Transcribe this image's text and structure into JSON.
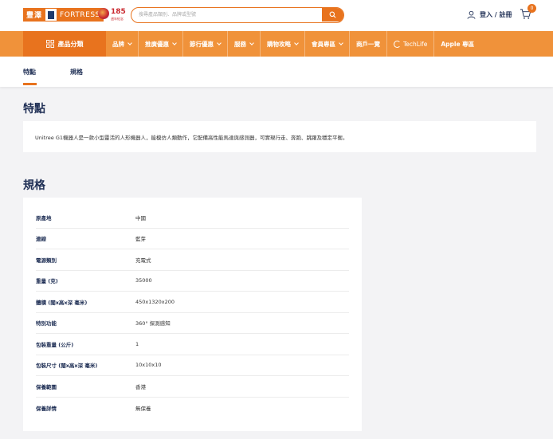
{
  "header": {
    "logo_cn": "豐澤",
    "logo_en": "FORTRESS",
    "anniversary_number": "185",
    "anniversary_sub": "週年紀念",
    "search_placeholder": "搜尋產品類別、品牌或型號",
    "login_label": "登入 / 註冊",
    "cart_count": "0",
    "colors": {
      "brand_orange": "#e8731e",
      "nav_orange": "#f0923a",
      "navy": "#1f2f55"
    }
  },
  "nav": {
    "category_label": "產品分類",
    "items": [
      {
        "label": "品牌",
        "dropdown": true
      },
      {
        "label": "推廣優惠",
        "dropdown": true
      },
      {
        "label": "節行優惠",
        "dropdown": true
      },
      {
        "label": "服務",
        "dropdown": true
      },
      {
        "label": "購物攻略",
        "dropdown": true
      },
      {
        "label": "會員專區",
        "dropdown": true
      },
      {
        "label": "商戶一覽",
        "dropdown": false
      },
      {
        "label": "TechLife",
        "dropdown": false
      },
      {
        "label": "Apple 專區",
        "dropdown": false
      }
    ]
  },
  "tabs": [
    {
      "label": "特點",
      "active": true
    },
    {
      "label": "規格",
      "active": false
    }
  ],
  "features": {
    "heading": "特點",
    "text": "Unitree G1機器人是一款小型靈活的人形機器人，能模仿人類動作，它配備高性能馬達與感測器，可實現行走、奔跑、跳躍及穩定平衡。"
  },
  "specs": {
    "heading": "規格",
    "rows": [
      {
        "label": "原產地",
        "value": "中國"
      },
      {
        "label": "連線",
        "value": "藍芽"
      },
      {
        "label": "電源類別",
        "value": "充電式"
      },
      {
        "label": "重量 (克)",
        "value": "35000"
      },
      {
        "label": "體積 (闊x高x深 毫米)",
        "value": "450x1320x200"
      },
      {
        "label": "特別功能",
        "value": "360° 探測感知"
      },
      {
        "label": "包裝重量 (公斤)",
        "value": "1"
      },
      {
        "label": "包裝尺寸 (闊x高x深 毫米)",
        "value": "10x10x10"
      },
      {
        "label": "保養範圍",
        "value": "香港"
      },
      {
        "label": "保養詳情",
        "value": "無保養"
      }
    ]
  }
}
